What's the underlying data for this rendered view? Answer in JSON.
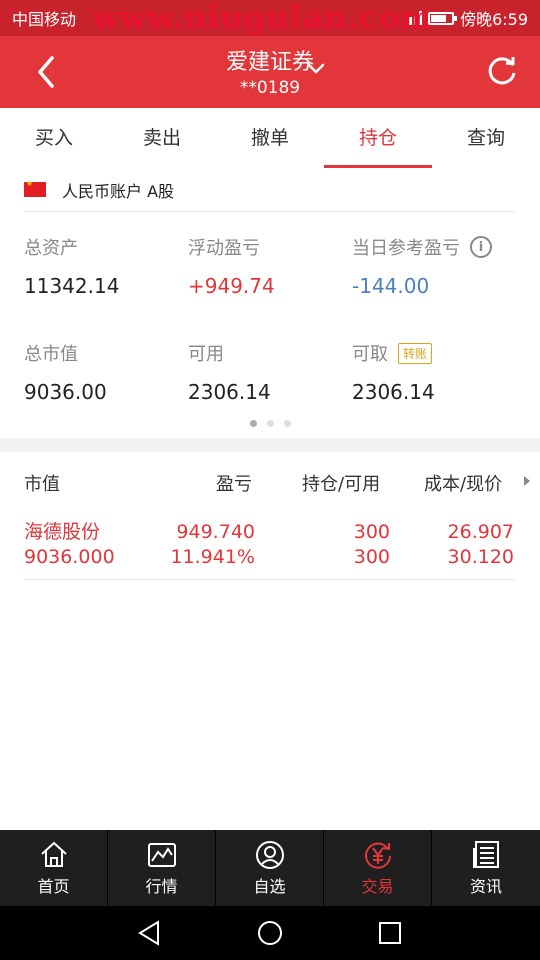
{
  "status_bar": {
    "carrier": "中国移动",
    "watermark": "www.niugulan.com",
    "time": "傍晚6:59"
  },
  "header": {
    "title": "爱建证券",
    "account": "**0189"
  },
  "tabs": [
    {
      "label": "买入",
      "active": false
    },
    {
      "label": "卖出",
      "active": false
    },
    {
      "label": "撤单",
      "active": false
    },
    {
      "label": "持仓",
      "active": true
    },
    {
      "label": "查询",
      "active": false
    }
  ],
  "account_row": {
    "label": "人民币账户 A股",
    "flag_icon": "china-flag-icon"
  },
  "summary": {
    "total_assets": {
      "label": "总资产",
      "value": "11342.14"
    },
    "floating_pl": {
      "label": "浮动盈亏",
      "value": "+949.74"
    },
    "daily_pl": {
      "label": "当日参考盈亏",
      "value": "-144.00"
    },
    "market_value": {
      "label": "总市值",
      "value": "9036.00"
    },
    "available": {
      "label": "可用",
      "value": "2306.14"
    },
    "withdrawable": {
      "label": "可取",
      "value": "2306.14",
      "badge": "转账"
    }
  },
  "holdings": {
    "headers": [
      "市值",
      "盈亏",
      "持仓/可用",
      "成本/现价"
    ],
    "rows": [
      {
        "name": "海德股份",
        "market_value": "9036.000",
        "pl": "949.740",
        "pl_pct": "11.941%",
        "position": "300",
        "available": "300",
        "cost": "26.907",
        "price": "30.120"
      }
    ]
  },
  "bottom_nav": [
    {
      "label": "首页",
      "icon": "home-icon",
      "active": false
    },
    {
      "label": "行情",
      "icon": "chart-icon",
      "active": false
    },
    {
      "label": "自选",
      "icon": "person-icon",
      "active": false
    },
    {
      "label": "交易",
      "icon": "yuan-icon",
      "active": true
    },
    {
      "label": "资讯",
      "icon": "news-icon",
      "active": false
    }
  ],
  "colors": {
    "brand_red": "#e2363b",
    "loss_blue": "#4a7fc1",
    "nav_bg": "#1f1f1f"
  }
}
